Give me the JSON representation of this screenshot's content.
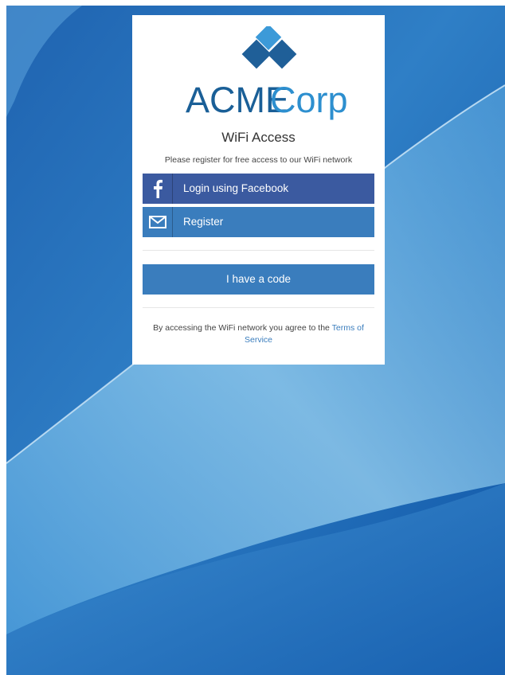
{
  "brand": {
    "name_part1": "ACME",
    "name_part2": "Corp",
    "logo_icon": "diamond-logo-icon",
    "colors": {
      "dark_blue": "#1a5f97",
      "light_blue": "#2d8fcf"
    }
  },
  "card": {
    "title": "WiFi Access",
    "subtitle": "Please register for free access to our WiFi network"
  },
  "buttons": {
    "facebook": {
      "label": "Login using Facebook",
      "icon": "facebook-icon",
      "color": "#3b5aa0"
    },
    "register": {
      "label": "Register",
      "icon": "envelope-icon",
      "color": "#3a7dbd"
    },
    "code": {
      "label": "I have a code",
      "color": "#3a7dbd"
    }
  },
  "terms": {
    "prefix": "By accessing the WiFi network you agree to the",
    "link_text": "Terms of Service"
  }
}
